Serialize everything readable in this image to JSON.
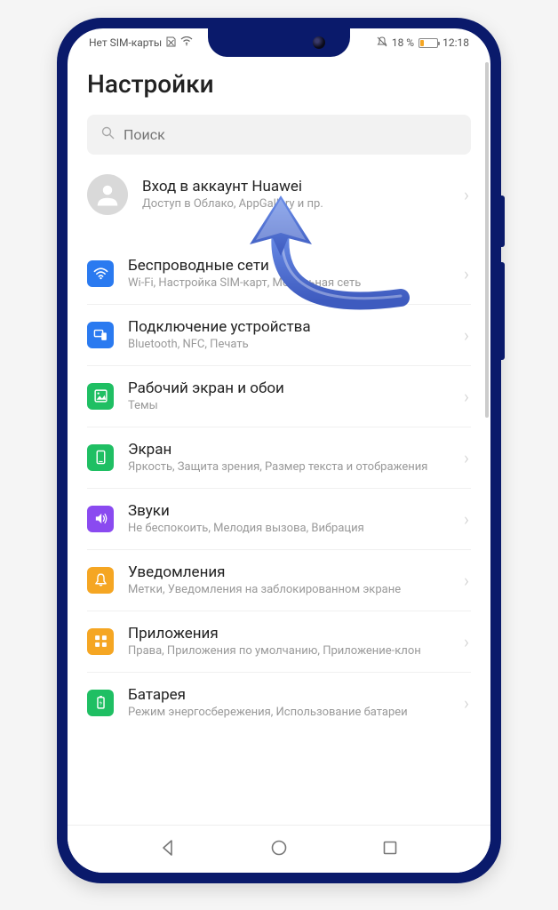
{
  "status": {
    "sim_text": "Нет SIM-карты",
    "battery_pct": "18 %",
    "time": "12:18"
  },
  "page": {
    "title": "Настройки"
  },
  "search": {
    "placeholder": "Поиск"
  },
  "account": {
    "title": "Вход в аккаунт Huawei",
    "subtitle": "Доступ в Облако, AppGallery и пр."
  },
  "settings": [
    {
      "title": "Беспроводные сети",
      "subtitle": "Wi-Fi, Настройка SIM-карт, Мобильная сеть",
      "icon": "wifi",
      "color": "ic-wifi"
    },
    {
      "title": "Подключение устройства",
      "subtitle": "Bluetooth, NFC, Печать",
      "icon": "device",
      "color": "ic-device"
    },
    {
      "title": "Рабочий экран и обои",
      "subtitle": "Темы",
      "icon": "home",
      "color": "ic-home"
    },
    {
      "title": "Экран",
      "subtitle": "Яркость, Защита зрения, Размер текста и отображения",
      "icon": "screen",
      "color": "ic-screen"
    },
    {
      "title": "Звуки",
      "subtitle": "Не беспокоить, Мелодия вызова, Вибрация",
      "icon": "sound",
      "color": "ic-sound"
    },
    {
      "title": "Уведомления",
      "subtitle": "Метки, Уведомления на заблокированном экране",
      "icon": "notif",
      "color": "ic-notif"
    },
    {
      "title": "Приложения",
      "subtitle": "Права, Приложения по умолчанию, Приложение-клон",
      "icon": "apps",
      "color": "ic-apps"
    },
    {
      "title": "Батарея",
      "subtitle": "Режим энергосбережения, Использование батареи",
      "icon": "batt",
      "color": "ic-batt"
    }
  ]
}
